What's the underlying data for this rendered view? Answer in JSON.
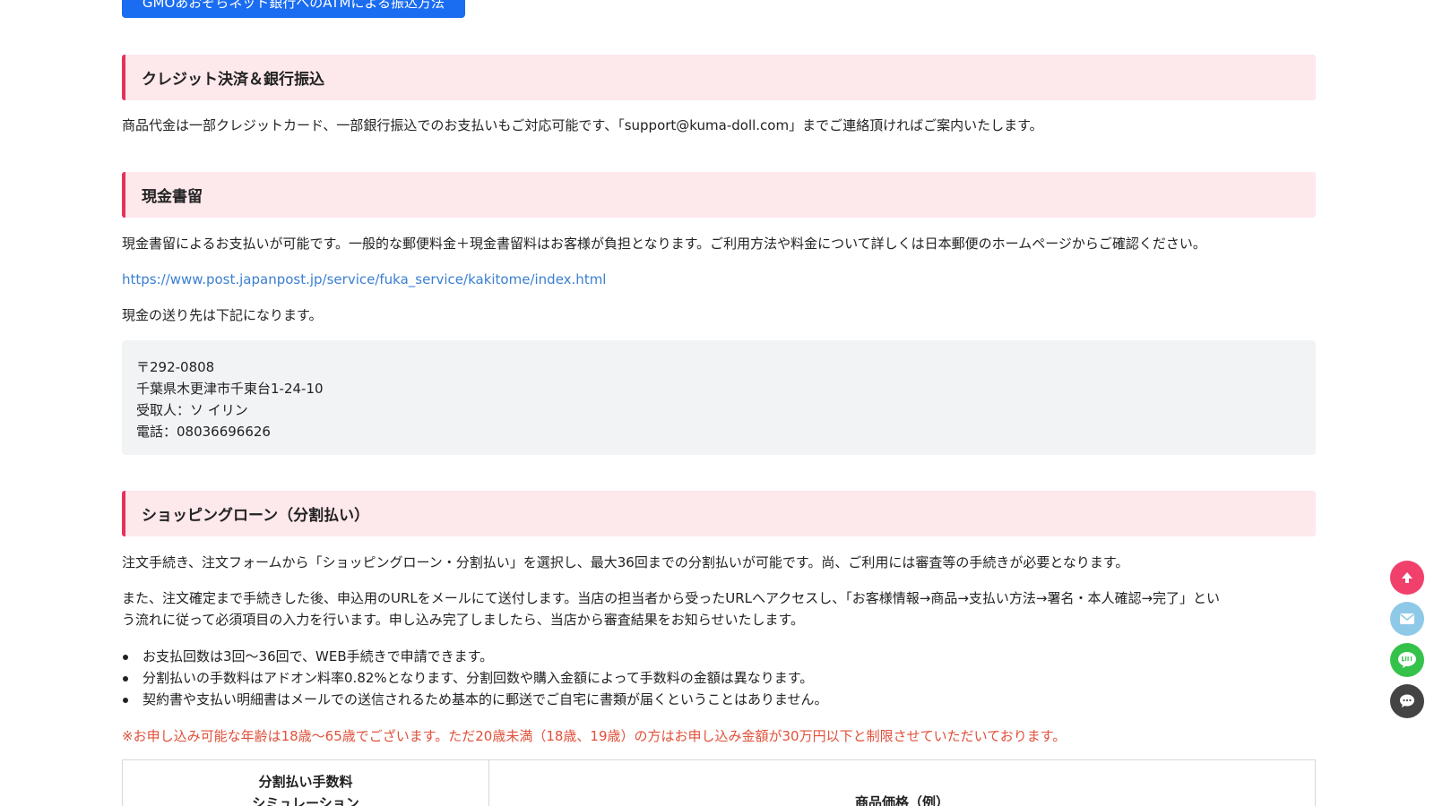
{
  "atm_button_label": "GMOあおぞらネット銀行へのATMによる振込方法",
  "credit": {
    "heading": "クレジット決済＆銀行振込",
    "text": "商品代金は一部クレジットカード、一部銀行振込でのお支払いもご対応可能です、「support@kuma-doll.com」までご連絡頂ければご案内いたします。"
  },
  "cash": {
    "heading": "現金書留",
    "text": "現金書留によるお支払いが可能です。一般的な郵便料金＋現金書留料はお客様が負担となります。ご利用方法や料金について詳しくは日本郵便のホームページからご確認ください。",
    "link": "https://www.post.japanpost.jp/service/fuka_service/kakitome/index.html",
    "destination_intro": "現金の送り先は下記になります。",
    "address": {
      "postal": "〒292-0808",
      "city": "千葉県木更津市千東台1-24-10",
      "recipient": "受取人：ソ イリン",
      "phone": "電話：08036696626"
    }
  },
  "loan": {
    "heading": "ショッピングローン（分割払い）",
    "para1": "注文手続き、注文フォームから「ショッピングローン・分割払い」を選択し、最大36回までの分割払いが可能です。尚、ご利用には審査等の手続きが必要となります。",
    "para2_line1": "また、注文確定まで手続きした後、申込用のURLをメールにて送付します。当店の担当者から受ったURLへアクセスし、「お客様情報→商品→支払い方法→署名・本人確認→完了」とい",
    "para2_line2": "う流れに従って必須項目の入力を行います。申し込み完了しましたら、当店から審査結果をお知らせいたします。",
    "bullets": [
      "お支払回数は3回〜36回で、WEB手続きで申請できます。",
      "分割払いの手数料はアドオン料率0.82%となります、分割回数や購入金額によって手数料の金額は異なります。",
      "契約書や支払い明細書はメールでの送信されるため基本的に郵送でご自宅に書類が届くということはありません。"
    ],
    "notice": "※お申し込み可能な年齢は18歳〜65歳でございます。ただ20歳未満（18歳、19歳）の方はお申し込み金額が30万円以下と制限させていただいております。",
    "table": {
      "left_header_line1": "分割払い手数料",
      "left_header_line2": "シミュレーション",
      "right_header": "商品価格（例）"
    }
  },
  "colors": {
    "accent": "#e8315a",
    "heading_bg": "#fde8ec",
    "button_blue": "#1a6cf0",
    "link": "#3b7fd1",
    "notice": "#e0503a"
  },
  "floating_buttons": [
    {
      "name": "scroll-top",
      "icon": "arrow-up-icon",
      "color": "#f0406b"
    },
    {
      "name": "mail",
      "icon": "mail-icon",
      "color": "#8ec9e8"
    },
    {
      "name": "line",
      "icon": "line-icon",
      "color": "#35c24a"
    },
    {
      "name": "chat",
      "icon": "chat-icon",
      "color": "#444444"
    }
  ]
}
